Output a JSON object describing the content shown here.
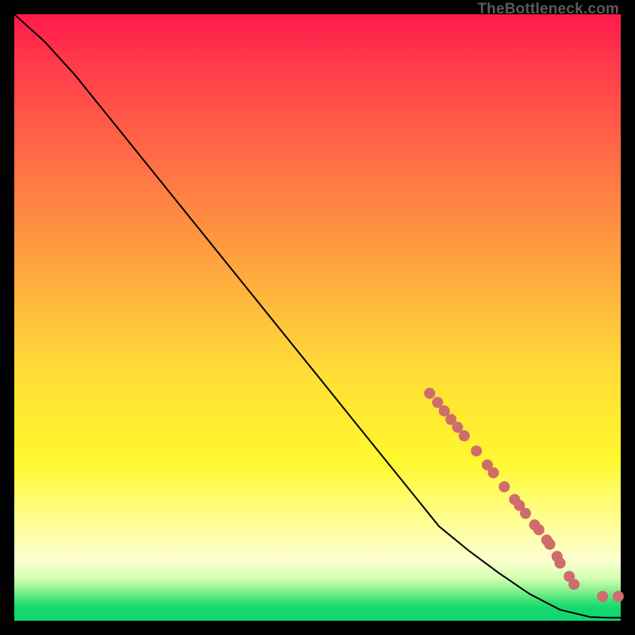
{
  "attribution": "TheBottleneck.com",
  "colors": {
    "marker": "#cf6d6d",
    "curve": "#000000",
    "page_bg": "#000000"
  },
  "chart_data": {
    "type": "line",
    "title": "",
    "xlabel": "",
    "ylabel": "",
    "xlim": [
      0,
      100
    ],
    "ylim": [
      0,
      100
    ],
    "axes_visible": false,
    "grid": false,
    "legend": false,
    "curve_points": [
      {
        "x": 0,
        "y": 100
      },
      {
        "x": 5,
        "y": 95.5
      },
      {
        "x": 10,
        "y": 90.0
      },
      {
        "x": 15,
        "y": 83.8
      },
      {
        "x": 20,
        "y": 77.6
      },
      {
        "x": 25,
        "y": 71.4
      },
      {
        "x": 30,
        "y": 65.2
      },
      {
        "x": 35,
        "y": 59.0
      },
      {
        "x": 40,
        "y": 52.8
      },
      {
        "x": 45,
        "y": 46.6
      },
      {
        "x": 50,
        "y": 40.4
      },
      {
        "x": 55,
        "y": 34.2
      },
      {
        "x": 60,
        "y": 28.0
      },
      {
        "x": 65,
        "y": 21.8
      },
      {
        "x": 70,
        "y": 15.6
      },
      {
        "x": 75,
        "y": 11.5
      },
      {
        "x": 80,
        "y": 7.8
      },
      {
        "x": 85,
        "y": 4.4
      },
      {
        "x": 90,
        "y": 1.8
      },
      {
        "x": 95,
        "y": 0.6
      },
      {
        "x": 98,
        "y": 0.5
      },
      {
        "x": 100,
        "y": 0.5
      }
    ],
    "markers": [
      {
        "x": 68.5,
        "y": 37.5
      },
      {
        "x": 69.8,
        "y": 36.0
      },
      {
        "x": 70.9,
        "y": 34.6
      },
      {
        "x": 72.0,
        "y": 33.2
      },
      {
        "x": 73.1,
        "y": 31.9
      },
      {
        "x": 74.2,
        "y": 30.5
      },
      {
        "x": 76.2,
        "y": 28.0
      },
      {
        "x": 78.0,
        "y": 25.7
      },
      {
        "x": 79.0,
        "y": 24.4
      },
      {
        "x": 80.8,
        "y": 22.1
      },
      {
        "x": 82.5,
        "y": 20.0
      },
      {
        "x": 83.3,
        "y": 19.0
      },
      {
        "x": 84.3,
        "y": 17.7
      },
      {
        "x": 85.8,
        "y": 15.8
      },
      {
        "x": 86.5,
        "y": 15.0
      },
      {
        "x": 87.8,
        "y": 13.3
      },
      {
        "x": 88.3,
        "y": 12.6
      },
      {
        "x": 89.5,
        "y": 10.6
      },
      {
        "x": 90.0,
        "y": 9.5
      },
      {
        "x": 91.5,
        "y": 7.3
      },
      {
        "x": 92.3,
        "y": 6.0
      },
      {
        "x": 97.0,
        "y": 4.0
      },
      {
        "x": 99.6,
        "y": 4.0
      }
    ],
    "marker_radius_px": 7
  }
}
